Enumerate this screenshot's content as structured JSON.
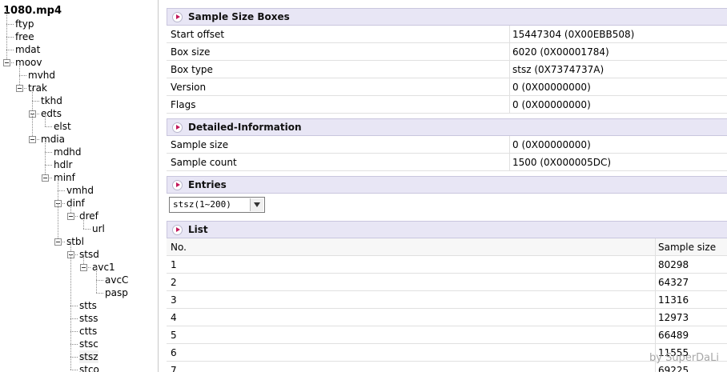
{
  "tree": {
    "root": "1080.mp4",
    "items": [
      {
        "label": "ftyp"
      },
      {
        "label": "free"
      },
      {
        "label": "mdat"
      },
      {
        "label": "moov"
      },
      {
        "label": "mvhd"
      },
      {
        "label": "trak"
      },
      {
        "label": "tkhd"
      },
      {
        "label": "edts"
      },
      {
        "label": "elst"
      },
      {
        "label": "mdia"
      },
      {
        "label": "mdhd"
      },
      {
        "label": "hdlr"
      },
      {
        "label": "minf"
      },
      {
        "label": "vmhd"
      },
      {
        "label": "dinf"
      },
      {
        "label": "dref"
      },
      {
        "label": "url"
      },
      {
        "label": "stbl"
      },
      {
        "label": "stsd"
      },
      {
        "label": "avc1"
      },
      {
        "label": "avcC"
      },
      {
        "label": "pasp"
      },
      {
        "label": "stts"
      },
      {
        "label": "stss"
      },
      {
        "label": "ctts"
      },
      {
        "label": "stsc"
      },
      {
        "label": "stsz"
      },
      {
        "label": "stco"
      }
    ]
  },
  "sections": {
    "sample_size_boxes": {
      "title": "Sample Size Boxes",
      "rows": [
        {
          "name": "Start offset",
          "value": "15447304 (0X00EBB508)"
        },
        {
          "name": "Box size",
          "value": "6020 (0X00001784)"
        },
        {
          "name": "Box type",
          "value": "stsz (0X7374737A)"
        },
        {
          "name": "Version",
          "value": "0 (0X00000000)"
        },
        {
          "name": "Flags",
          "value": "0 (0X00000000)"
        }
      ]
    },
    "detailed": {
      "title": "Detailed-Information",
      "rows": [
        {
          "name": "Sample size",
          "value": "0 (0X00000000)"
        },
        {
          "name": "Sample count",
          "value": "1500 (0X000005DC)"
        }
      ]
    },
    "entries": {
      "title": "Entries",
      "selected": "stsz(1~200)"
    },
    "list": {
      "title": "List",
      "headers": [
        "No.",
        "Sample size"
      ],
      "rows": [
        {
          "no": "1",
          "size": "80298"
        },
        {
          "no": "2",
          "size": "64327"
        },
        {
          "no": "3",
          "size": "11316"
        },
        {
          "no": "4",
          "size": "12973"
        },
        {
          "no": "5",
          "size": "66489"
        },
        {
          "no": "6",
          "size": "11555"
        },
        {
          "no": "7",
          "size": "69225"
        }
      ]
    }
  },
  "watermark": "by SuperDaLi"
}
